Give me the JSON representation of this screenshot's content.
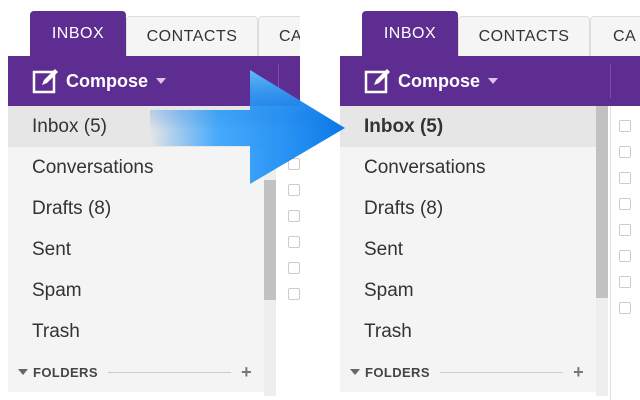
{
  "tabs": [
    {
      "label": "INBOX",
      "active": true
    },
    {
      "label": "CONTACTS",
      "active": false
    },
    {
      "label": "CA",
      "active": false
    }
  ],
  "toolbar": {
    "compose_label": "Compose"
  },
  "nav": {
    "items": [
      {
        "label": "Inbox (5)"
      },
      {
        "label": "Conversations"
      },
      {
        "label": "Drafts (8)"
      },
      {
        "label": "Sent"
      },
      {
        "label": "Spam"
      },
      {
        "label": "Trash"
      }
    ],
    "folders_label": "FOLDERS",
    "add_symbol": "+"
  },
  "colors": {
    "brand": "#5e2d91",
    "arrow": "#1e90ff"
  }
}
